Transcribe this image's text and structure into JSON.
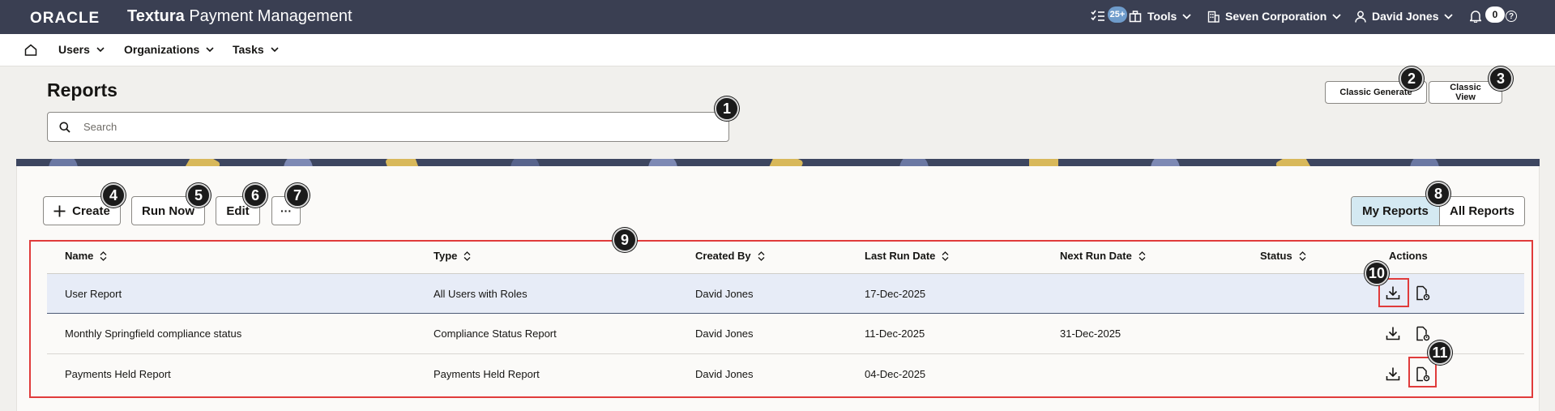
{
  "header": {
    "brand": "ORACLE",
    "product_bold": "Textura",
    "product_rest": " Payment Management",
    "tasks_badge": "25+",
    "tools": "Tools",
    "company": "Seven Corporation",
    "user": "David Jones",
    "notifications_badge": "0",
    "help": "?"
  },
  "nav": {
    "items": [
      {
        "label": "Users"
      },
      {
        "label": "Organizations"
      },
      {
        "label": "Tasks"
      }
    ]
  },
  "page": {
    "title": "Reports",
    "search_placeholder": "Search",
    "classic_generate": "Classic Generate",
    "classic_view": "Classic View"
  },
  "toolbar": {
    "create": "Create",
    "run_now": "Run Now",
    "edit": "Edit",
    "more": "···",
    "my_reports": "My Reports",
    "all_reports": "All Reports"
  },
  "table": {
    "columns": [
      "Name",
      "Type",
      "Created By",
      "Last Run Date",
      "Next Run Date",
      "Status",
      "Actions"
    ],
    "rows": [
      {
        "name": "User Report",
        "type": "All Users with Roles",
        "created_by": "David Jones",
        "last_run": "17-Dec-2025",
        "next_run": "",
        "status": ""
      },
      {
        "name": "Monthly Springfield compliance status",
        "type": "Compliance Status Report",
        "created_by": "David Jones",
        "last_run": "11-Dec-2025",
        "next_run": "31-Dec-2025",
        "status": ""
      },
      {
        "name": "Payments Held Report",
        "type": "Payments Held Report",
        "created_by": "David Jones",
        "last_run": "04-Dec-2025",
        "next_run": "",
        "status": ""
      }
    ]
  },
  "callouts": [
    "1",
    "2",
    "3",
    "4",
    "5",
    "6",
    "7",
    "8",
    "9",
    "10",
    "11"
  ],
  "colors": {
    "header_bg": "#3a3f52",
    "selected_segment": "#d4e9f2",
    "selected_row": "#e7ecf7",
    "annotation_red": "#e03b3b"
  }
}
